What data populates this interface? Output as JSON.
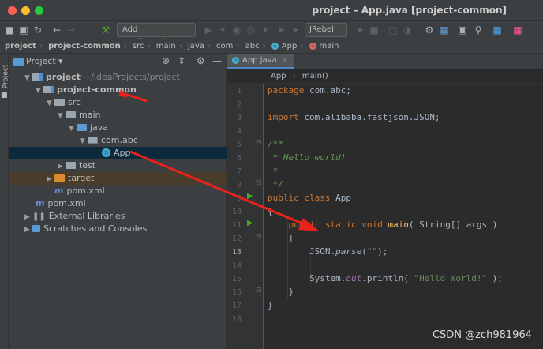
{
  "window": {
    "title": "project – App.java [project-common]"
  },
  "toolbar": {
    "run_config": "Add Configuration...",
    "jrebel": "JRebel"
  },
  "breadcrumb": [
    "project",
    "project-common",
    "src",
    "main",
    "java",
    "com",
    "abc",
    "App",
    "main"
  ],
  "sidebar": {
    "strip_label": "Project"
  },
  "project_panel": {
    "title": "Project",
    "tree": {
      "root_label": "project",
      "root_path": "~/IdeaProjects/project",
      "module": "project-common",
      "src": "src",
      "main": "main",
      "java": "java",
      "package": "com.abc",
      "app_class": "App",
      "test": "test",
      "target": "target",
      "module_pom": "pom.xml",
      "root_pom": "pom.xml",
      "ext_libs": "External Libraries",
      "scratches": "Scratches and Consoles"
    }
  },
  "editor": {
    "tab_label": "App.java",
    "crumb_class": "App",
    "crumb_method": "main()",
    "line_numbers": [
      "1",
      "2",
      "3",
      "4",
      "5",
      "6",
      "7",
      "8",
      "9",
      "10",
      "11",
      "12",
      "13",
      "14",
      "15",
      "16",
      "17",
      "18"
    ],
    "current_line": 13,
    "code": {
      "l1_kw": "package",
      "l1_rest": " com.abc;",
      "l3_kw": "import",
      "l3_rest": " com.alibaba.fastjson.JSON;",
      "l5": "/**",
      "l6": " * Hello world!",
      "l7": " *",
      "l8": " */",
      "l9_kw": "public class",
      "l9_rest": " App",
      "l10": "{",
      "l11_kw1": "public static void",
      "l11_fn": " main",
      "l11_rest": "( String[] args )",
      "l12": "    {",
      "l13_a": "        JSON.",
      "l13_b": "parse",
      "l13_c": "(",
      "l13_str": "\"\"",
      "l13_d": ");",
      "l15_a": "        System.",
      "l15_fld": "out",
      "l15_b": ".println( ",
      "l15_str": "\"Hello World!\"",
      "l15_c": " );",
      "l16": "    }",
      "l17": "}"
    }
  },
  "watermark": "CSDN @zch981964",
  "colors": {
    "keyword": "#cc7832",
    "comment": "#629755",
    "string": "#6a8759",
    "annotation_arrow": "#e8231c"
  }
}
